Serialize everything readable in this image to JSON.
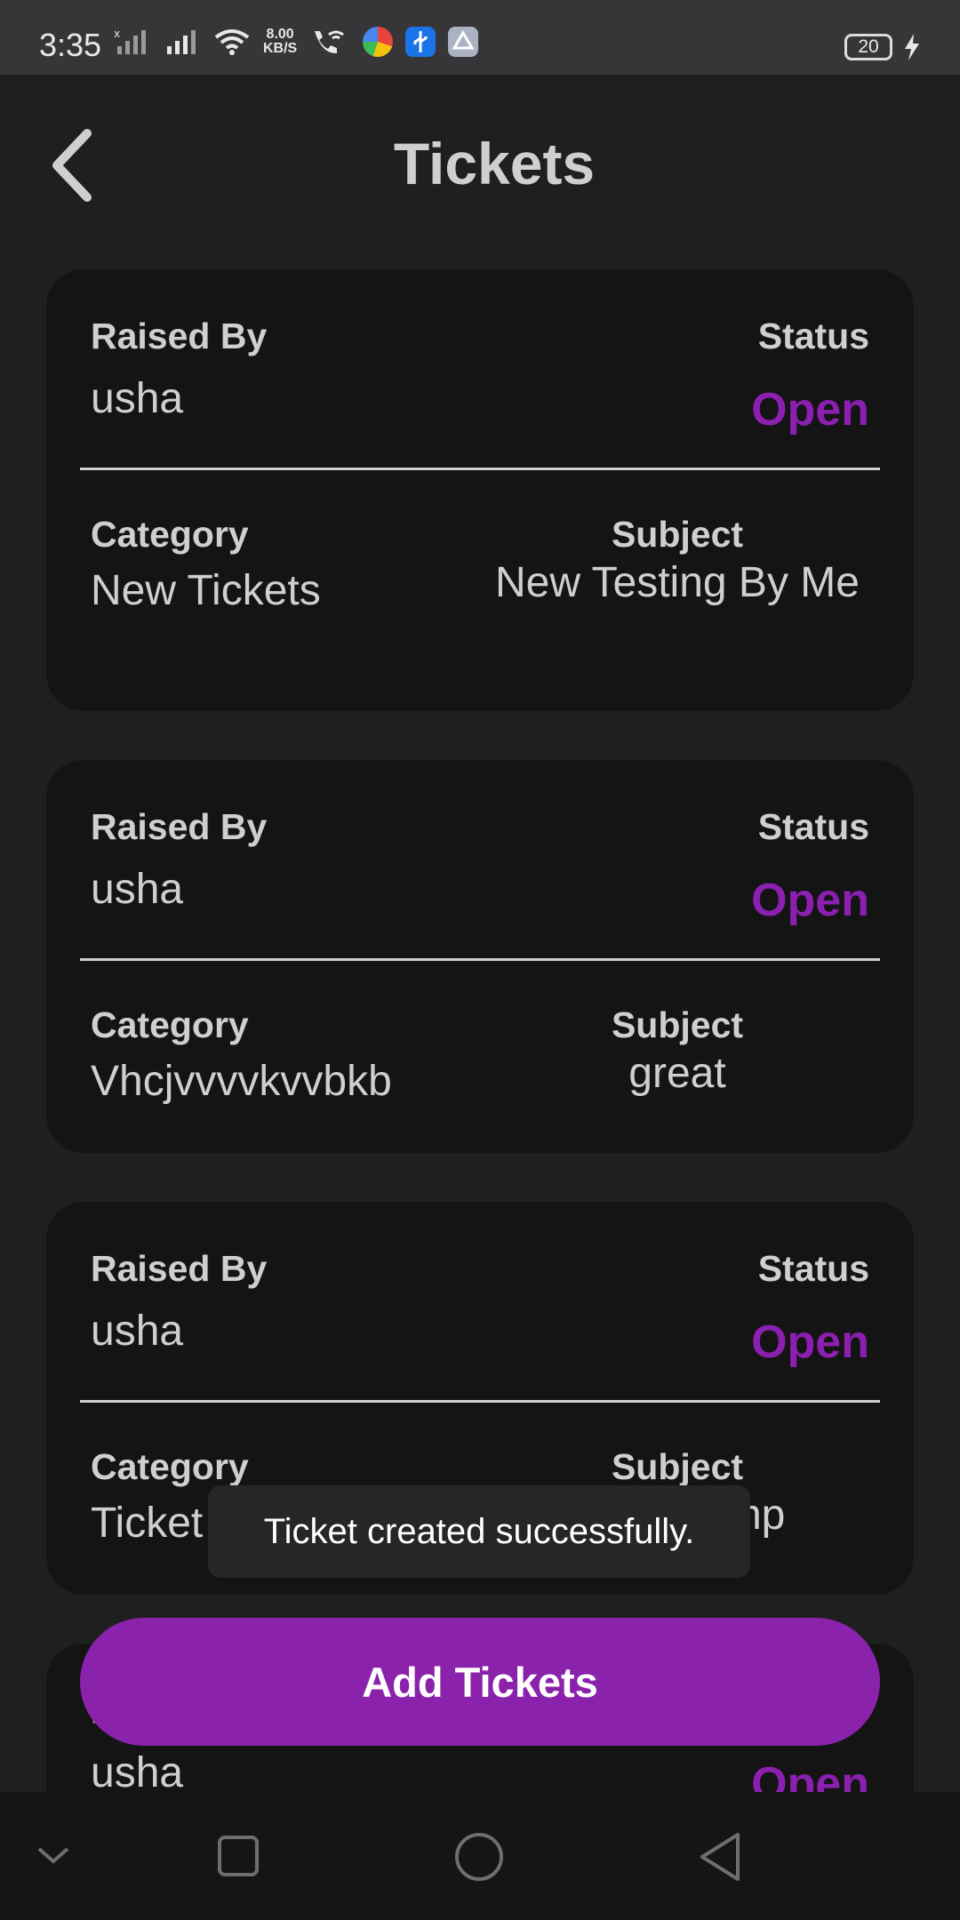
{
  "status_bar": {
    "time": "3:35",
    "net_speed_value": "8.00",
    "net_speed_unit": "KB/S",
    "battery": "20"
  },
  "header": {
    "title": "Tickets"
  },
  "labels": {
    "raised_by": "Raised By",
    "status": "Status",
    "category": "Category",
    "subject": "Subject"
  },
  "tickets": [
    {
      "raised_by": "usha",
      "status": "Open",
      "category": "New Tickets",
      "subject": "New Testing By Me"
    },
    {
      "raised_by": "usha",
      "status": "Open",
      "category": "Vhcjvvvvkvvbkb",
      "subject": "great"
    },
    {
      "raised_by": "usha",
      "status": "Open",
      "category": "Ticket cat",
      "subject": "subject imp"
    },
    {
      "raised_by": "usha",
      "status": "Open"
    }
  ],
  "toast": "Ticket created successfully.",
  "add_button": "Add Tickets",
  "colors": {
    "accent": "#8b22ab",
    "status_open": "#8b1fb0",
    "background": "#1e201f",
    "card": "#141414"
  }
}
